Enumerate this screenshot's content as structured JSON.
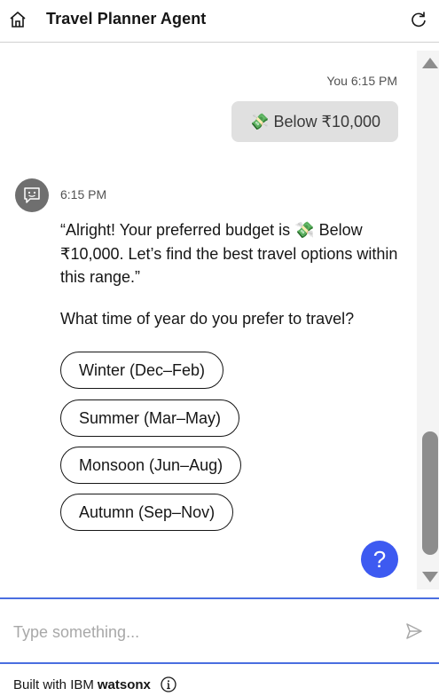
{
  "header": {
    "title": "Travel Planner Agent",
    "home_icon": "home-icon",
    "restart_icon": "restart-icon"
  },
  "conversation": {
    "user_message": {
      "sender": "You",
      "time": "6:15 PM",
      "text": "💸 Below ₹10,000"
    },
    "bot_message": {
      "avatar_icon": "chatbot-icon",
      "time": "6:15 PM",
      "text": "“Alright! Your preferred budget is 💸 Below ₹10,000. Let’s find the best travel options within this range.”",
      "question": "What time of year do you prefer to travel?",
      "options": [
        "Winter (Dec–Feb)",
        "Summer (Mar–May)",
        "Monsoon (Jun–Aug)",
        "Autumn (Sep–Nov)"
      ]
    }
  },
  "help_button": {
    "label": "?",
    "color": "#3d5af1"
  },
  "input": {
    "placeholder": "Type something...",
    "value": "",
    "send_icon": "send-icon"
  },
  "footer": {
    "prefix": "Built with IBM",
    "brand": "watsonx",
    "info_icon": "info-icon"
  },
  "colors": {
    "accent": "#4a6ee0",
    "user_bubble": "#e0e0e0",
    "avatar": "#6f6f6f"
  }
}
